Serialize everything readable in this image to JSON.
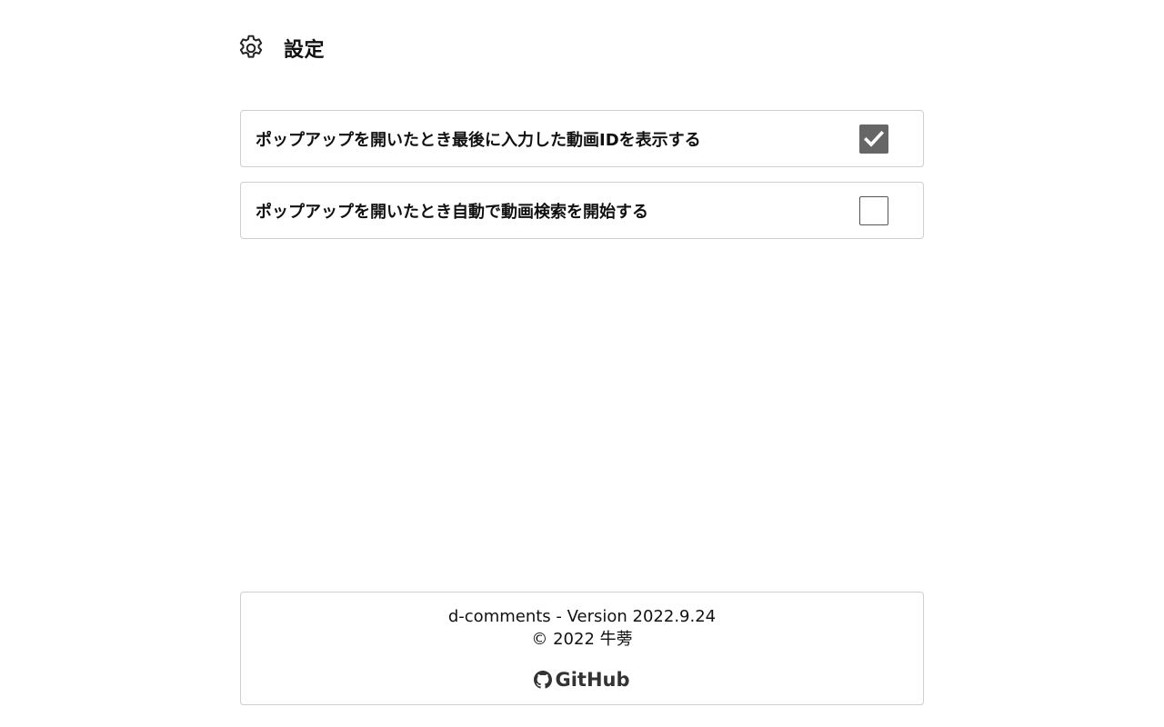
{
  "header": {
    "title": "設定",
    "icon": "gear-icon"
  },
  "options": [
    {
      "label": "ポップアップを開いたとき最後に入力した動画IDを表示する",
      "checked": true
    },
    {
      "label": "ポップアップを開いたとき自動で動画検索を開始する",
      "checked": false
    }
  ],
  "footer": {
    "version": "d-comments - Version 2022.9.24",
    "copyright": "© 2022 牛蒡",
    "github_label": "GitHub",
    "github_icon": "github-icon"
  },
  "colors": {
    "checkbox_checked": "#666666",
    "border": "#cfcfcf",
    "text": "#111111"
  }
}
